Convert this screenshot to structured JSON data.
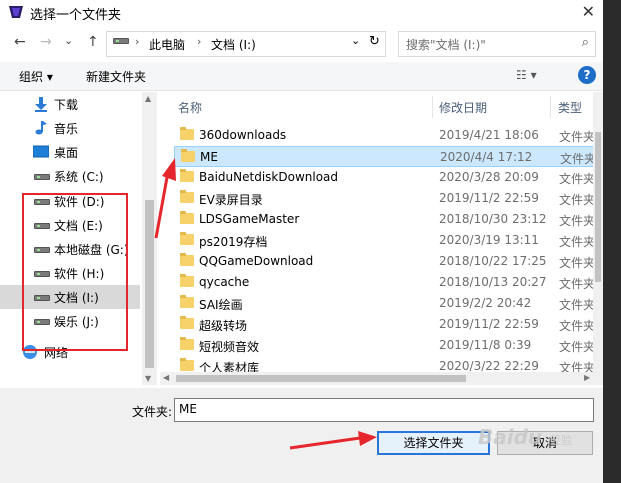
{
  "window": {
    "title": "选择一个文件夹",
    "close": "✕"
  },
  "nav": {
    "back": "←",
    "forward": "→",
    "recent": "⌄",
    "up": "↑",
    "breadcrumb": [
      "此电脑",
      "文档 (I:)"
    ],
    "dropdown": "⌄",
    "refresh": "↻",
    "search_placeholder": "搜索\"文档 (I:)\""
  },
  "toolbar": {
    "organize": "组织 ▾",
    "new_folder": "新建文件夹",
    "view": "☷ ▾",
    "help": "?"
  },
  "sidebar": {
    "items": [
      {
        "label": "下载",
        "icon": "download-icon"
      },
      {
        "label": "音乐",
        "icon": "music-icon"
      },
      {
        "label": "桌面",
        "icon": "desktop-icon"
      },
      {
        "label": "系统 (C:)",
        "icon": "drive-icon"
      },
      {
        "label": "软件 (D:)",
        "icon": "drive-icon"
      },
      {
        "label": "文档 (E:)",
        "icon": "drive-icon"
      },
      {
        "label": "本地磁盘 (G:)",
        "icon": "drive-icon"
      },
      {
        "label": "软件 (H:)",
        "icon": "drive-icon"
      },
      {
        "label": "文档 (I:)",
        "icon": "drive-icon",
        "selected": true
      },
      {
        "label": "娱乐 (J:)",
        "icon": "drive-icon"
      },
      {
        "label": "网络",
        "icon": "network-icon"
      }
    ]
  },
  "columns": {
    "name": "名称",
    "date": "修改日期",
    "type": "类型"
  },
  "files": [
    {
      "name": "360downloads",
      "date": "2019/4/21 18:06",
      "type": "文件夹"
    },
    {
      "name": "ME",
      "date": "2020/4/4 17:12",
      "type": "文件夹",
      "selected": true
    },
    {
      "name": "BaiduNetdiskDownload",
      "date": "2020/3/28 20:09",
      "type": "文件夹"
    },
    {
      "name": "EV录屏目录",
      "date": "2019/11/2 22:59",
      "type": "文件夹"
    },
    {
      "name": "LDSGameMaster",
      "date": "2018/10/30 23:12",
      "type": "文件夹"
    },
    {
      "name": "ps2019存档",
      "date": "2020/3/19 13:11",
      "type": "文件夹"
    },
    {
      "name": "QQGameDownload",
      "date": "2018/10/22 17:25",
      "type": "文件夹"
    },
    {
      "name": "qycache",
      "date": "2018/10/13 20:27",
      "type": "文件夹"
    },
    {
      "name": "SAI绘画",
      "date": "2019/2/2 20:42",
      "type": "文件夹"
    },
    {
      "name": "超级转场",
      "date": "2019/11/2 22:59",
      "type": "文件夹"
    },
    {
      "name": "短视频音效",
      "date": "2019/11/8 0:39",
      "type": "文件夹"
    },
    {
      "name": "个人素材库",
      "date": "2020/3/22 22:29",
      "type": "文件夹"
    }
  ],
  "footer": {
    "folder_label": "文件夹:",
    "folder_value": "ME",
    "select_button": "选择文件夹",
    "cancel_button": "取消"
  },
  "watermark": {
    "brand": "Baidu",
    "sub": "经验"
  },
  "colors": {
    "annotation_red": "#e5262d",
    "selection_blue": "#cce8ff",
    "accent_blue": "#2b74d9"
  }
}
